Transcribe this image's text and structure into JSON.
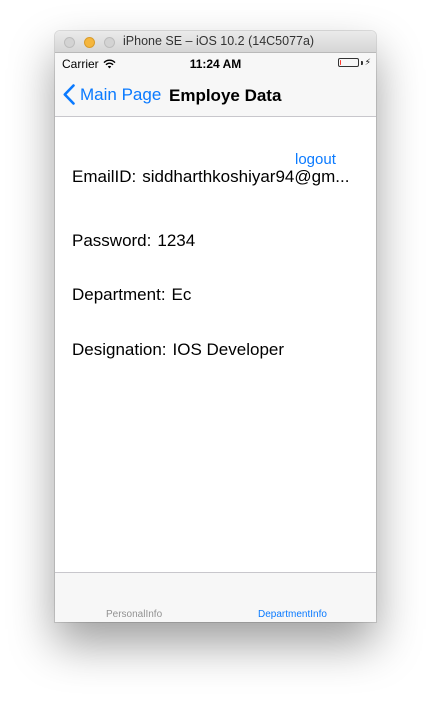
{
  "window": {
    "title": "iPhone SE – iOS 10.2 (14C5077a)"
  },
  "status_bar": {
    "carrier": "Carrier",
    "time": "11:24 AM",
    "battery_level": 0.08,
    "battery_color": "#ff3b30"
  },
  "nav_bar": {
    "back_label": "Main Page",
    "title": "Employe Data"
  },
  "content": {
    "logout_label": "logout",
    "fields": [
      {
        "label": "EmailID:",
        "value": "siddharthkoshiyar94@gm..."
      },
      {
        "label": "Password:",
        "value": "1234"
      },
      {
        "label": "Department:",
        "value": "Ec"
      },
      {
        "label": "Designation:",
        "value": "IOS Developer"
      }
    ]
  },
  "tab_bar": {
    "tabs": [
      {
        "label": "PersonalInfo",
        "selected": false
      },
      {
        "label": "DepartmentInfo",
        "selected": true
      }
    ]
  },
  "colors": {
    "tint": "#0a7aff",
    "inactive_tab": "#929292"
  }
}
